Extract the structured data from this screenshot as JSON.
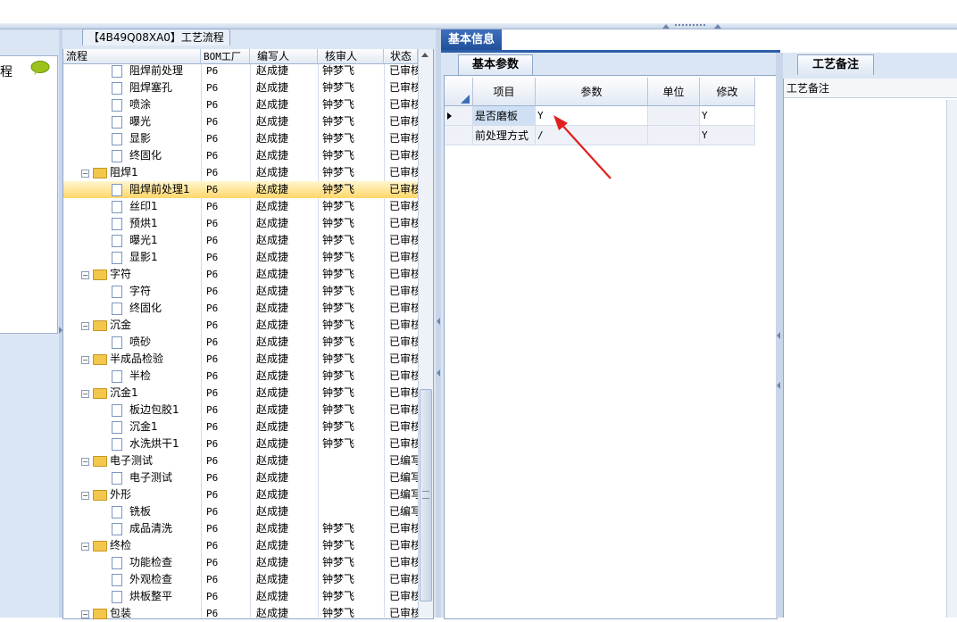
{
  "tree_panel": {
    "title": "【4B49Q08XA0】工艺流程",
    "columns": [
      "流程",
      "BOM工厂",
      "编写人",
      "核审人",
      "状态"
    ],
    "rows": [
      {
        "label": "阻焊前处理",
        "type": "doc",
        "level": 2,
        "factory": "P6",
        "author": "赵成捷",
        "reviewer": "钟梦飞",
        "status": "已审核"
      },
      {
        "label": "阻焊塞孔",
        "type": "doc",
        "level": 2,
        "factory": "P6",
        "author": "赵成捷",
        "reviewer": "钟梦飞",
        "status": "已审核"
      },
      {
        "label": "喷涂",
        "type": "doc",
        "level": 2,
        "factory": "P6",
        "author": "赵成捷",
        "reviewer": "钟梦飞",
        "status": "已审核"
      },
      {
        "label": "曝光",
        "type": "doc",
        "level": 2,
        "factory": "P6",
        "author": "赵成捷",
        "reviewer": "钟梦飞",
        "status": "已审核"
      },
      {
        "label": "显影",
        "type": "doc",
        "level": 2,
        "factory": "P6",
        "author": "赵成捷",
        "reviewer": "钟梦飞",
        "status": "已审核"
      },
      {
        "label": "终固化",
        "type": "doc",
        "level": 2,
        "factory": "P6",
        "author": "赵成捷",
        "reviewer": "钟梦飞",
        "status": "已审核"
      },
      {
        "label": "阻焊1",
        "type": "folder",
        "level": 1,
        "factory": "P6",
        "author": "赵成捷",
        "reviewer": "钟梦飞",
        "status": "已审核"
      },
      {
        "label": "阻焊前处理1",
        "type": "doc",
        "level": 2,
        "factory": "P6",
        "author": "赵成捷",
        "reviewer": "钟梦飞",
        "status": "已审核",
        "selected": true
      },
      {
        "label": "丝印1",
        "type": "doc",
        "level": 2,
        "factory": "P6",
        "author": "赵成捷",
        "reviewer": "钟梦飞",
        "status": "已审核"
      },
      {
        "label": "预烘1",
        "type": "doc",
        "level": 2,
        "factory": "P6",
        "author": "赵成捷",
        "reviewer": "钟梦飞",
        "status": "已审核"
      },
      {
        "label": "曝光1",
        "type": "doc",
        "level": 2,
        "factory": "P6",
        "author": "赵成捷",
        "reviewer": "钟梦飞",
        "status": "已审核"
      },
      {
        "label": "显影1",
        "type": "doc",
        "level": 2,
        "factory": "P6",
        "author": "赵成捷",
        "reviewer": "钟梦飞",
        "status": "已审核"
      },
      {
        "label": "字符",
        "type": "folder",
        "level": 1,
        "factory": "P6",
        "author": "赵成捷",
        "reviewer": "钟梦飞",
        "status": "已审核"
      },
      {
        "label": "字符",
        "type": "doc",
        "level": 2,
        "factory": "P6",
        "author": "赵成捷",
        "reviewer": "钟梦飞",
        "status": "已审核"
      },
      {
        "label": "终固化",
        "type": "doc",
        "level": 2,
        "factory": "P6",
        "author": "赵成捷",
        "reviewer": "钟梦飞",
        "status": "已审核"
      },
      {
        "label": "沉金",
        "type": "folder",
        "level": 1,
        "factory": "P6",
        "author": "赵成捷",
        "reviewer": "钟梦飞",
        "status": "已审核"
      },
      {
        "label": "喷砂",
        "type": "doc",
        "level": 2,
        "factory": "P6",
        "author": "赵成捷",
        "reviewer": "钟梦飞",
        "status": "已审核"
      },
      {
        "label": "半成品检验",
        "type": "folder",
        "level": 1,
        "factory": "P6",
        "author": "赵成捷",
        "reviewer": "钟梦飞",
        "status": "已审核"
      },
      {
        "label": "半检",
        "type": "doc",
        "level": 2,
        "factory": "P6",
        "author": "赵成捷",
        "reviewer": "钟梦飞",
        "status": "已审核"
      },
      {
        "label": "沉金1",
        "type": "folder",
        "level": 1,
        "factory": "P6",
        "author": "赵成捷",
        "reviewer": "钟梦飞",
        "status": "已审核"
      },
      {
        "label": "板边包胶1",
        "type": "doc",
        "level": 2,
        "factory": "P6",
        "author": "赵成捷",
        "reviewer": "钟梦飞",
        "status": "已审核"
      },
      {
        "label": "沉金1",
        "type": "doc",
        "level": 2,
        "factory": "P6",
        "author": "赵成捷",
        "reviewer": "钟梦飞",
        "status": "已审核"
      },
      {
        "label": "水洗烘干1",
        "type": "doc",
        "level": 2,
        "factory": "P6",
        "author": "赵成捷",
        "reviewer": "钟梦飞",
        "status": "已审核"
      },
      {
        "label": "电子测试",
        "type": "folder",
        "level": 1,
        "factory": "P6",
        "author": "赵成捷",
        "reviewer": "",
        "status": "已编写"
      },
      {
        "label": "电子测试",
        "type": "doc",
        "level": 2,
        "factory": "P6",
        "author": "赵成捷",
        "reviewer": "",
        "status": "已编写"
      },
      {
        "label": "外形",
        "type": "folder",
        "level": 1,
        "factory": "P6",
        "author": "赵成捷",
        "reviewer": "",
        "status": "已编写"
      },
      {
        "label": "铣板",
        "type": "doc",
        "level": 2,
        "factory": "P6",
        "author": "赵成捷",
        "reviewer": "",
        "status": "已编写"
      },
      {
        "label": "成品清洗",
        "type": "doc",
        "level": 2,
        "factory": "P6",
        "author": "赵成捷",
        "reviewer": "钟梦飞",
        "status": "已审核"
      },
      {
        "label": "终检",
        "type": "folder",
        "level": 1,
        "factory": "P6",
        "author": "赵成捷",
        "reviewer": "钟梦飞",
        "status": "已审核"
      },
      {
        "label": "功能检查",
        "type": "doc",
        "level": 2,
        "factory": "P6",
        "author": "赵成捷",
        "reviewer": "钟梦飞",
        "status": "已审核"
      },
      {
        "label": "外观检查",
        "type": "doc",
        "level": 2,
        "factory": "P6",
        "author": "赵成捷",
        "reviewer": "钟梦飞",
        "status": "已审核"
      },
      {
        "label": "烘板整平",
        "type": "doc",
        "level": 2,
        "factory": "P6",
        "author": "赵成捷",
        "reviewer": "钟梦飞",
        "status": "已审核"
      },
      {
        "label": "包装",
        "type": "folder",
        "level": 1,
        "factory": "P6",
        "author": "赵成捷",
        "reviewer": "钟梦飞",
        "status": "已审核"
      }
    ]
  },
  "left_panel": {
    "fragment": "程"
  },
  "info_panel": {
    "tab": "基本信息",
    "subtab": "基本参数",
    "columns": [
      "项目",
      "参数",
      "单位",
      "修改"
    ],
    "rows": [
      {
        "item": "是否磨板",
        "param": "Y",
        "unit": "",
        "modify": "Y"
      },
      {
        "item": "前处理方式",
        "param": "/",
        "unit": "",
        "modify": "Y"
      }
    ]
  },
  "notes_panel": {
    "tab": "工艺备注",
    "label": "工艺备注"
  },
  "colors": {
    "selection": "#ffd76a",
    "accent": "#1f4f99",
    "annotation_arrow": "#e02020"
  },
  "icons": [
    "speech-bubble-icon",
    "folder-icon",
    "document-icon",
    "expand-toggle-icon",
    "row-pointer-icon",
    "red-arrow-annotation"
  ]
}
